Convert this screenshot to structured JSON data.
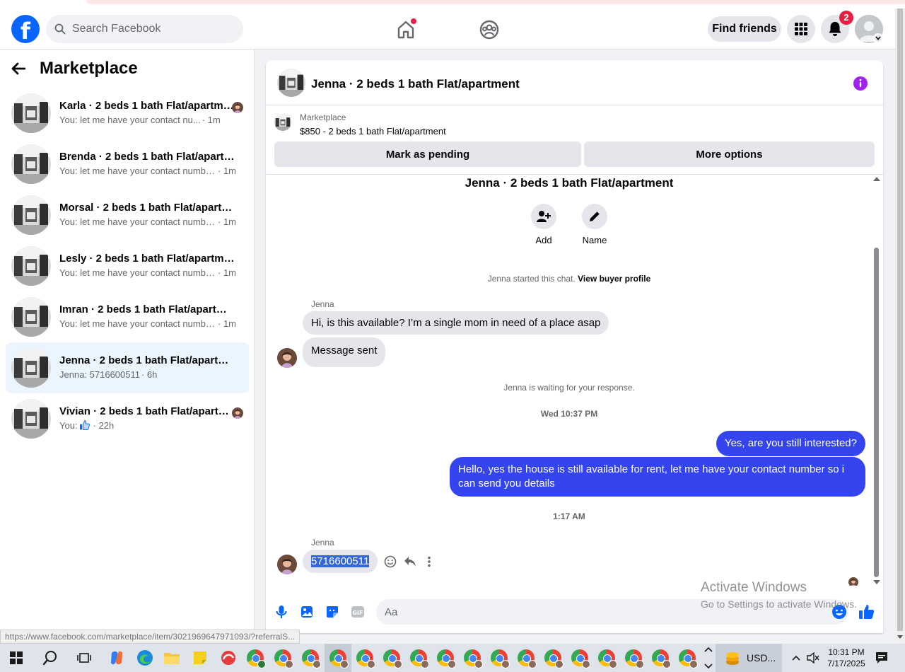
{
  "topbar": {
    "search_placeholder": "Search Facebook",
    "find_friends": "Find friends",
    "notifications_count": "2",
    "brand_color": "#0866ff"
  },
  "sidebar": {
    "title": "Marketplace",
    "items": [
      {
        "title": "Karla · 2 beds 1 bath Flat/apartment",
        "snippet": "You: let me have your contact nu...",
        "time": "· 1m",
        "has_avatar": true
      },
      {
        "title": "Brenda · 2 beds 1 bath Flat/apartment",
        "snippet": "You: let me have your contact numbe...",
        "time": "· 1m",
        "has_avatar": false
      },
      {
        "title": "Morsal · 2 beds 1 bath Flat/apartment",
        "snippet": "You: let me have your contact numbe...",
        "time": "· 1m",
        "has_avatar": false
      },
      {
        "title": "Lesly · 2 beds 1 bath Flat/apartment",
        "snippet": "You: let me have your contact numbe...",
        "time": "· 1m",
        "has_avatar": false
      },
      {
        "title": "Imran · 2 beds 1 bath Flat/apartment",
        "snippet": "You: let me have your contact numbe...",
        "time": "· 1m",
        "has_avatar": false
      },
      {
        "title": "Jenna · 2 beds 1 bath Flat/apartment",
        "snippet": "Jenna: 5716600511",
        "time": "· 6h",
        "has_avatar": false,
        "active": true
      },
      {
        "title": "Vivian · 2 beds 1 bath Flat/apartment",
        "snippet": "You: ",
        "time": "· 22h",
        "has_avatar": true,
        "like": true
      }
    ]
  },
  "chat": {
    "header_title": "Jenna · 2 beds 1 bath Flat/apartment",
    "listing_source": "Marketplace",
    "listing_price": "$850 - 2 beds 1 bath Flat/apartment",
    "mark_pending": "Mark as pending",
    "more_options": "More options",
    "thread_title": "Jenna · 2 beds 1 bath Flat/apartment",
    "action_add": "Add",
    "action_name": "Name",
    "started_text": "Jenna started this chat.",
    "buyer_profile_link": "View buyer profile",
    "sender1": "Jenna",
    "msg1": "Hi, is this available? I’m a single mom in need of a place asap",
    "msg2": "Message sent",
    "waiting": "Jenna is waiting for your response.",
    "time1": "Wed 10:37 PM",
    "out1": "Yes, are you still interested?",
    "out2": "Hello, yes the house is still available for rent, let me have your contact number so i can send you details",
    "time2": "1:17 AM",
    "sender2": "Jenna",
    "msg3": "5716600511",
    "composer_placeholder": "Aa",
    "outgoing_color": "#3445f0"
  },
  "watermark": {
    "line1": "Activate Windows",
    "line2": "Go to Settings to activate Windows."
  },
  "status_url": "https://www.facebook.com/marketplace/item/3021969647971093/?referralS...",
  "taskbar": {
    "usd_label": "USD...",
    "time": "10:31 PM",
    "date": "7/17/2025"
  }
}
